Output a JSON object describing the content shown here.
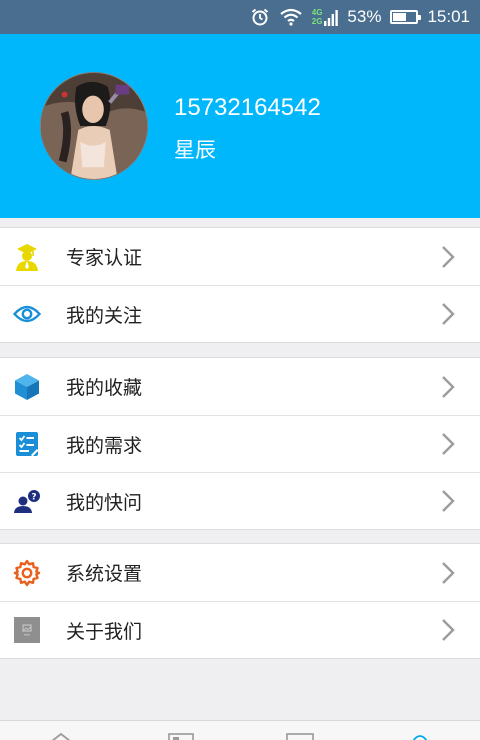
{
  "status_bar": {
    "battery_percent": "53%",
    "time": "15:01",
    "net_top": "4G",
    "net_bottom": "2G",
    "battery_level": 0.53
  },
  "profile": {
    "phone": "15732164542",
    "nickname": "星辰"
  },
  "menu": {
    "group1": [
      {
        "label": "专家认证",
        "icon": "expert-graduate-icon"
      },
      {
        "label": "我的关注",
        "icon": "eye-icon"
      }
    ],
    "group2": [
      {
        "label": "我的收藏",
        "icon": "cube-icon"
      },
      {
        "label": "我的需求",
        "icon": "checklist-icon"
      },
      {
        "label": "我的快问",
        "icon": "question-user-icon"
      }
    ],
    "group3": [
      {
        "label": "系统设置",
        "icon": "gear-icon"
      },
      {
        "label": "关于我们",
        "icon": "image-placeholder-icon"
      }
    ]
  },
  "colors": {
    "header": "#00b7fc",
    "status_bar": "#4a6e8f"
  }
}
